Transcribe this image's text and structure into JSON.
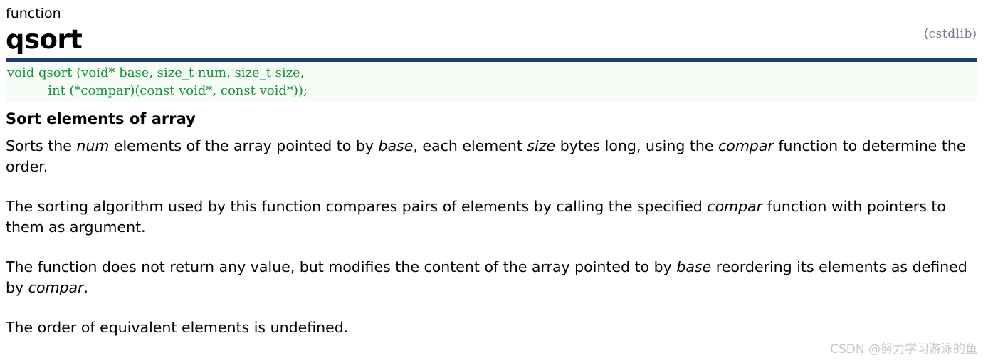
{
  "header": {
    "kind": "function",
    "name": "qsort",
    "include": "⟨cstdlib⟩"
  },
  "signature": {
    "line1_prefix": "void qsort ",
    "line1_rest": "(void* base, size_t num, size_t size,",
    "line2_indent": "          ",
    "line2": "int (*compar)(const void*, const void*));",
    "text_color": "#1a8f3c",
    "background": "#f6fdf6"
  },
  "rule": {
    "color": "#1c3f6e"
  },
  "body": {
    "heading": "Sort elements of array",
    "paragraphs": [
      {
        "parts": [
          {
            "text": "Sorts the ",
            "italic": false
          },
          {
            "text": "num",
            "italic": true
          },
          {
            "text": " elements of the array pointed to by ",
            "italic": false
          },
          {
            "text": "base",
            "italic": true
          },
          {
            "text": ", each element ",
            "italic": false
          },
          {
            "text": "size",
            "italic": true
          },
          {
            "text": " bytes long, using the ",
            "italic": false
          },
          {
            "text": "compar",
            "italic": true
          },
          {
            "text": " function to determine the order.",
            "italic": false
          }
        ]
      },
      {
        "parts": [
          {
            "text": "The sorting algorithm used by this function compares pairs of elements by calling the specified ",
            "italic": false
          },
          {
            "text": "compar",
            "italic": true
          },
          {
            "text": " function with pointers to them as argument.",
            "italic": false
          }
        ]
      },
      {
        "parts": [
          {
            "text": "The function does not return any value, but modifies the content of the array pointed to by ",
            "italic": false
          },
          {
            "text": "base",
            "italic": true
          },
          {
            "text": " reordering its elements as defined by ",
            "italic": false
          },
          {
            "text": "compar",
            "italic": true
          },
          {
            "text": ".",
            "italic": false
          }
        ]
      },
      {
        "parts": [
          {
            "text": "The order of equivalent elements is undefined.",
            "italic": false
          }
        ]
      }
    ]
  },
  "watermark": {
    "text": "CSDN @努力学习游泳的鱼",
    "color": "#c8c8c8"
  }
}
